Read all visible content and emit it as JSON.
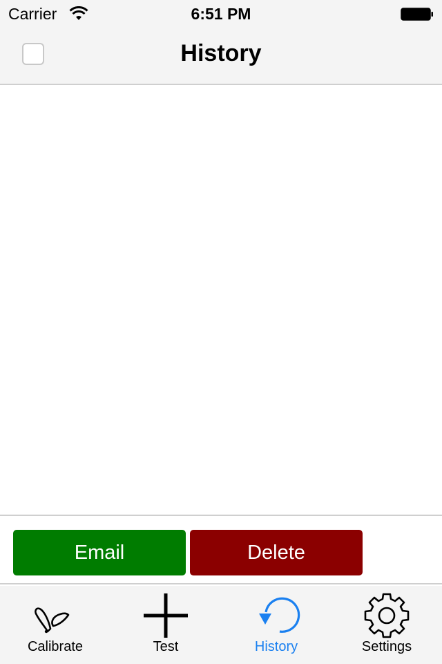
{
  "status_bar": {
    "carrier": "Carrier",
    "time": "6:51 PM",
    "wifi_icon": "wifi-icon",
    "battery_icon": "battery-full-icon"
  },
  "nav_bar": {
    "title": "History",
    "select_all_checked": false
  },
  "history_list": {
    "items": []
  },
  "actions": {
    "email_label": "Email",
    "delete_label": "Delete",
    "email_color": "#007c00",
    "delete_color": "#8b0000"
  },
  "tab_bar": {
    "active_color": "#1a80f0",
    "tabs": [
      {
        "label": "Calibrate",
        "icon": "sprout-icon",
        "active": false
      },
      {
        "label": "Test",
        "icon": "plus-icon",
        "active": false
      },
      {
        "label": "History",
        "icon": "history-icon",
        "active": true
      },
      {
        "label": "Settings",
        "icon": "gear-icon",
        "active": false
      }
    ]
  }
}
